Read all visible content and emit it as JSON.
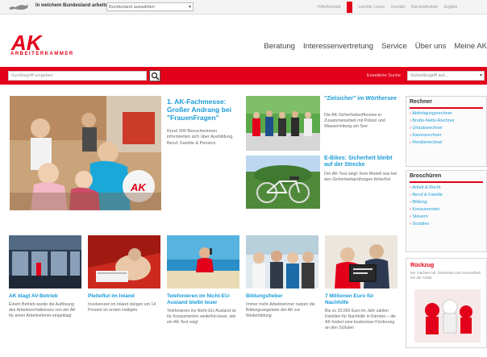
{
  "topbar": {
    "region_question": "In welchem Bundesland arbeiten Sie?",
    "region_select": "Bundesland auswählen",
    "util_links": [
      "Hilfe/Kontakt",
      "Leichter Lesen",
      "Kontakt",
      "Barrierefreiheit",
      "English"
    ]
  },
  "logo": {
    "text": "AK",
    "sub": "ARBEITERKAMMER"
  },
  "nav": {
    "items": [
      "Beratung",
      "Interessenvertretung",
      "Service",
      "Über uns",
      "Meine AK"
    ]
  },
  "search": {
    "placeholder": "Suchbegriff eingeben",
    "advanced": "Erweiterte Suche",
    "shortcut_placeholder": "Schnellzugriff auf..."
  },
  "featured": {
    "headline": "1. AK-Fachmesse: Großer Andrang bei \"FrauenFragen\"",
    "teaser": "Rund 300 Besucherinnen informierten sich über Ausbildung, Beruf, Familie & Pension"
  },
  "side_news": [
    {
      "headline": "\"Zielsicher\" im Wörthersee",
      "teaser": "Die AK-Sicherheitsoffensive in Zusammenarbeit mit Polizei und Wasserrettung am See"
    },
    {
      "headline": "E-Bikes: Sicherheit bleibt auf der Strecke",
      "teaser": "Der AK-Test zeigt: Kein Modell war bei den Sicherheitsprüfungen fehlerfrei"
    }
  ],
  "bottom_news": [
    {
      "headline": "AK klagt AV-Betrieb",
      "teaser": "Einem Betrieb wurde die Auflösung des Arbeitsverhältnisses von der AK für einen Arbeitnehmer eingeklagt"
    },
    {
      "headline": "Pleiteflut im Inland",
      "teaser": "Insolvenzen im Inland steigen um 14 Prozent im ersten Halbjahr"
    },
    {
      "headline": "Telefonieren im Nicht-EU-Ausland bleibt teuer",
      "teaser": "Telefonieren ins Nicht-EU-Ausland ist für Konsumenten weiterhin teuer, wie ein AK-Test zeigt"
    },
    {
      "headline": "Bildungsfieber",
      "teaser": "Immer mehr Arbeitnehmer nutzen die Bildungsangebote der AK zur Weiterbildung"
    },
    {
      "headline": "7 Millionen Euro für Nachhilfe",
      "teaser": "Bis zu 23.000 Euro im Jahr zahlen Familien für Nachhilfe in Kärnten – die AK fordert eine kostenlose Förderung an den Schulen"
    }
  ],
  "sidebar": {
    "rechner_title": "Rechner",
    "rechner_items": [
      "Abfertigungsrechner",
      "Brutto-Netto-Rechner",
      "Urlaubsrechner",
      "Karenzrechner",
      "Pendlerrechner"
    ],
    "broschueren_title": "Broschüren",
    "broschueren_items": [
      "Arbeit & Recht",
      "Beruf & Familie",
      "Bildung",
      "Konsumenten",
      "Steuern",
      "Soziales"
    ],
    "ad_title": "Rückzug",
    "ad_text": "Wir machen mit: Sicherheit und Gesundheit bei der Arbeit"
  },
  "colors": {
    "brand_red": "#e2001a",
    "link_blue": "#1a9bd7"
  }
}
